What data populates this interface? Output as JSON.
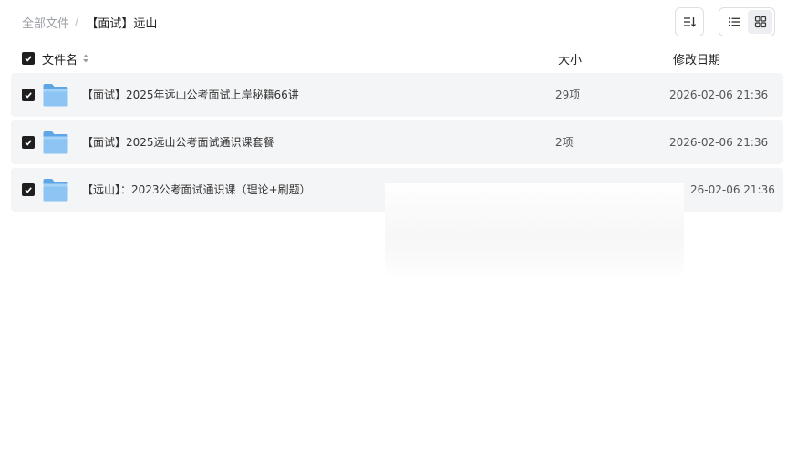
{
  "breadcrumb": {
    "root": "全部文件",
    "separator": "/",
    "current": "【面试】远山"
  },
  "toolbar": {
    "sort_icon": "sort-icon",
    "list_view_icon": "list-view-icon",
    "grid_view_icon": "grid-view-icon",
    "active_view": "list"
  },
  "table": {
    "headers": {
      "name": "文件名",
      "size": "大小",
      "date": "修改日期"
    },
    "rows": [
      {
        "name": "【面试】2025年远山公考面试上岸秘籍66讲",
        "size": "29项",
        "date": "2026-02-06 21:36",
        "checked": true,
        "icon": "folder-icon"
      },
      {
        "name": "【面试】2025远山公考面试通识课套餐",
        "size": "2项",
        "date": "2026-02-06 21:36",
        "checked": true,
        "icon": "folder-icon"
      },
      {
        "name": "【远山】：2023公考面试通识课（理论+刷题）",
        "size": "",
        "date": "26-02-06 21:36",
        "checked": true,
        "icon": "folder-icon"
      }
    ]
  },
  "colors": {
    "checkbox": "#1f1f1f",
    "row_background": "#f4f5f6",
    "folder": "#7ab8ef"
  }
}
